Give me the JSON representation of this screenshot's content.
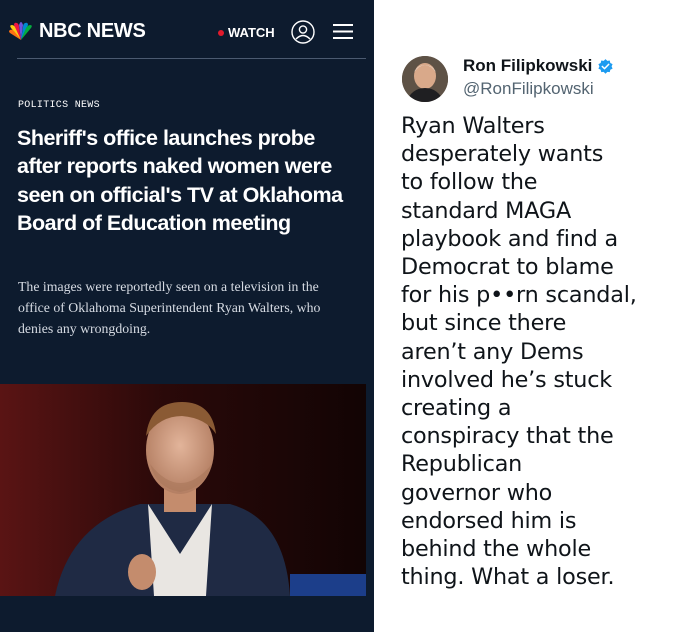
{
  "article": {
    "brand": "NBC NEWS",
    "watch_label": "WATCH",
    "kicker": "POLITICS NEWS",
    "headline": "Sheriff's office launches probe after reports naked women were seen on official's TV at Oklahoma Board of Education meeting",
    "dek": "The images were reportedly seen on a television in the office of Oklahoma Superintendent Ryan Walters, who denies any wrongdoing.",
    "icons": [
      "peacock-logo-icon",
      "account-icon",
      "menu-icon"
    ],
    "colors": {
      "background": "#0d1b2e",
      "live_dot": "#e21a2c",
      "headline": "#ffffff"
    }
  },
  "tweet": {
    "author_name": "Ron Filipkowski",
    "author_handle": "@RonFilipkowski",
    "verified": true,
    "lines": [
      "Ryan Walters",
      "desperately wants",
      "to follow the",
      "standard MAGA",
      "playbook and find a",
      "Democrat to blame",
      "for his p••rn scandal,",
      "but since there",
      "aren’t any Dems",
      "involved he’s stuck",
      "creating a",
      "conspiracy that the",
      "Republican",
      "governor who",
      "endorsed him is",
      "behind the whole",
      "thing. What a loser."
    ],
    "colors": {
      "verified": "#1d9bf0",
      "handle": "#536471",
      "text": "#0f1419"
    }
  }
}
